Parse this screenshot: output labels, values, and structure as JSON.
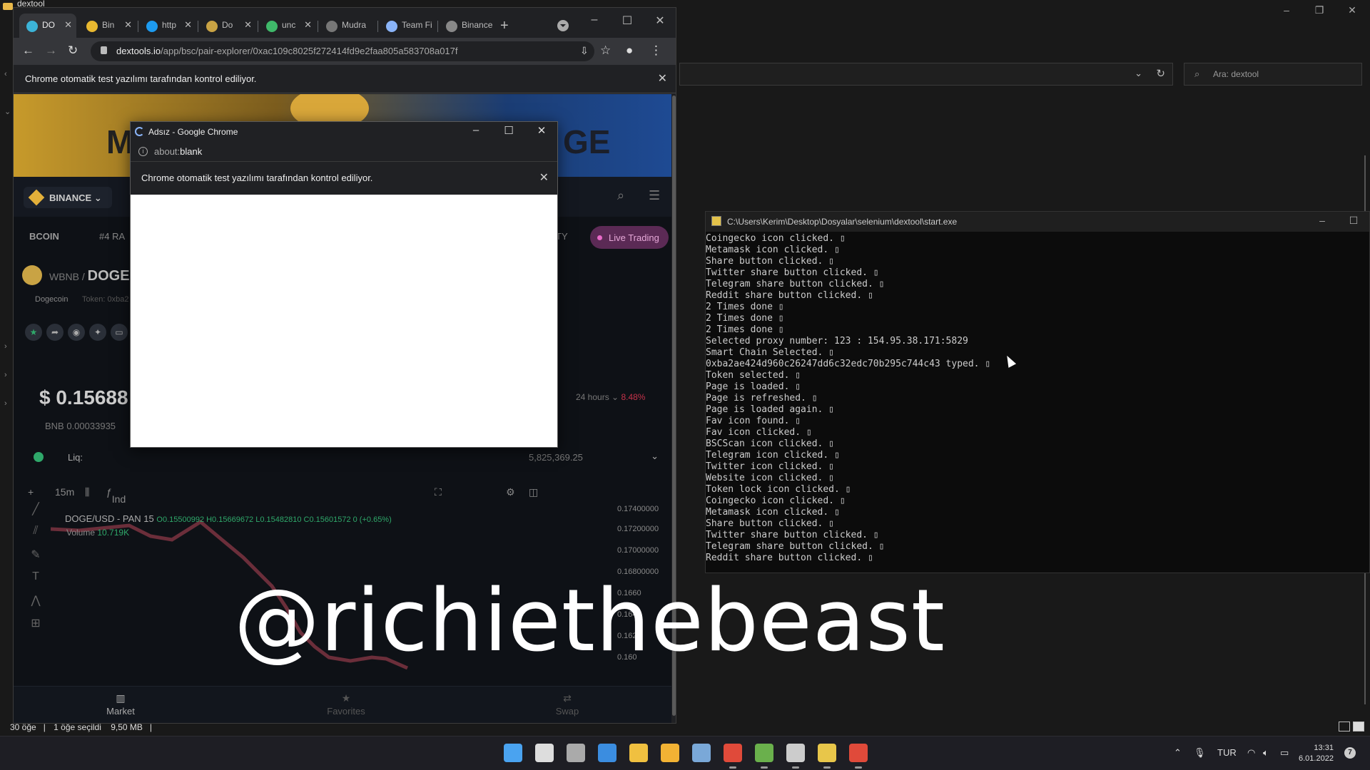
{
  "explorer": {
    "title": "dextool",
    "search_placeholder": "Ara: dextool",
    "status": {
      "items": "30 öğe",
      "selected": "1 öğe seçildi",
      "size": "9,50 MB"
    }
  },
  "chrome": {
    "tabs": [
      {
        "label": "DO",
        "favicon_color": "#3cb4d8"
      },
      {
        "label": "Bin",
        "favicon_color": "#e8b830"
      },
      {
        "label": "http",
        "favicon_color": "#1d9bf0"
      },
      {
        "label": "Do",
        "favicon_color": "#c9a344"
      },
      {
        "label": "unc",
        "favicon_color": "#3fb96a"
      },
      {
        "label": "Mudra",
        "favicon_color": "#777777"
      },
      {
        "label": "Team Fi",
        "favicon_color": "#8ab4f8"
      },
      {
        "label": "Binance",
        "favicon_color": "#888888"
      }
    ],
    "url_domain": "dextools.io",
    "url_path": "/app/bsc/pair-explorer/0xac109c8025f272414fd9e2faa805a583708a017f",
    "infobar_text": "Chrome otomatik test yazılımı tarafından kontrol ediliyor.",
    "page": {
      "chain_label": "BINANCE",
      "ticker_coin": "BCOIN",
      "ticker_rank": "#4 RA",
      "ticker_right": "TY",
      "live_trading": "Live Trading",
      "pair_base": "WBNB /",
      "pair_quote": "DOGE",
      "pair_name": "Dogecoin",
      "pair_token": "Token: 0xba2",
      "price": "$ 0.15688",
      "price_bnb": "BNB 0.00033935",
      "change_label": "24 hours",
      "change_value": "8.48%",
      "liq_label": "Liq:",
      "liq_value": "5,825,369.25",
      "interval": "15m",
      "indicators": "Ind",
      "chart_title": "DOGE/USD - PAN",
      "chart_interval": "15",
      "ohlc": "O0.15500992 H0.15669672 L0.15482810 C0.15601572 0 (+0.65%)",
      "volume_label": "Volume",
      "volume_value": "10.719K",
      "yaxis": [
        "0.17400000",
        "0.17200000",
        "0.17000000",
        "0.16800000",
        "0.1660",
        "0.1640",
        "0.1620",
        "0.160"
      ],
      "bottom_nav": [
        "Market",
        "Favorites",
        "Swap"
      ]
    }
  },
  "popup": {
    "title": "Adsız - Google Chrome",
    "address_prefix": "about:",
    "address_main": "blank",
    "infobar_text": "Chrome otomatik test yazılımı tarafından kontrol ediliyor."
  },
  "console": {
    "title": "C:\\Users\\Kerim\\Desktop\\Dosyalar\\selenium\\dextool\\start.exe",
    "lines": [
      "Coingecko icon clicked. ▯",
      "Metamask icon clicked. ▯",
      "Share button clicked. ▯",
      "Twitter share button clicked. ▯",
      "Telegram share button clicked. ▯",
      "Reddit share button clicked. ▯",
      "2 Times done ▯",
      "2 Times done ▯",
      "2 Times done ▯",
      "Selected proxy number: 123 : 154.95.38.171:5829",
      "Smart Chain Selected. ▯",
      "0xba2ae424d960c26247dd6c32edc70b295c744c43 typed. ▯",
      "Token selected. ▯",
      "Page is loaded. ▯",
      "Page is refreshed. ▯",
      "Page is loaded again. ▯",
      "Fav icon found. ▯",
      "Fav icon clicked. ▯",
      "BSCScan icon clicked. ▯",
      "Telegram icon clicked. ▯",
      "Twitter icon clicked. ▯",
      "Website icon clicked. ▯",
      "Token lock icon clicked. ▯",
      "Coingecko icon clicked. ▯",
      "Metamask icon clicked. ▯",
      "Share button clicked. ▯",
      "Twitter share button clicked. ▯",
      "Telegram share button clicked. ▯",
      "Reddit share button clicked. ▯"
    ]
  },
  "watermark": "@richiethebeast",
  "taskbar": {
    "apps": [
      {
        "name": "start",
        "color": "#4aa3f0"
      },
      {
        "name": "search",
        "color": "#dddddd"
      },
      {
        "name": "task-view",
        "color": "#aaaaaa"
      },
      {
        "name": "widgets",
        "color": "#3b8de0"
      },
      {
        "name": "file-explorer",
        "color": "#f0c040"
      },
      {
        "name": "store",
        "color": "#f2b234"
      },
      {
        "name": "photos",
        "color": "#7aa8d8"
      },
      {
        "name": "chrome",
        "color": "#e04a3a"
      },
      {
        "name": "notepad",
        "color": "#6ab04c"
      },
      {
        "name": "chatgpt",
        "color": "#cccccc"
      },
      {
        "name": "python",
        "color": "#e8c64a"
      },
      {
        "name": "chrome-active",
        "color": "#e04a3a"
      }
    ],
    "language": "TUR",
    "time": "13:31",
    "date": "6.01.2022",
    "notification_count": "7"
  }
}
